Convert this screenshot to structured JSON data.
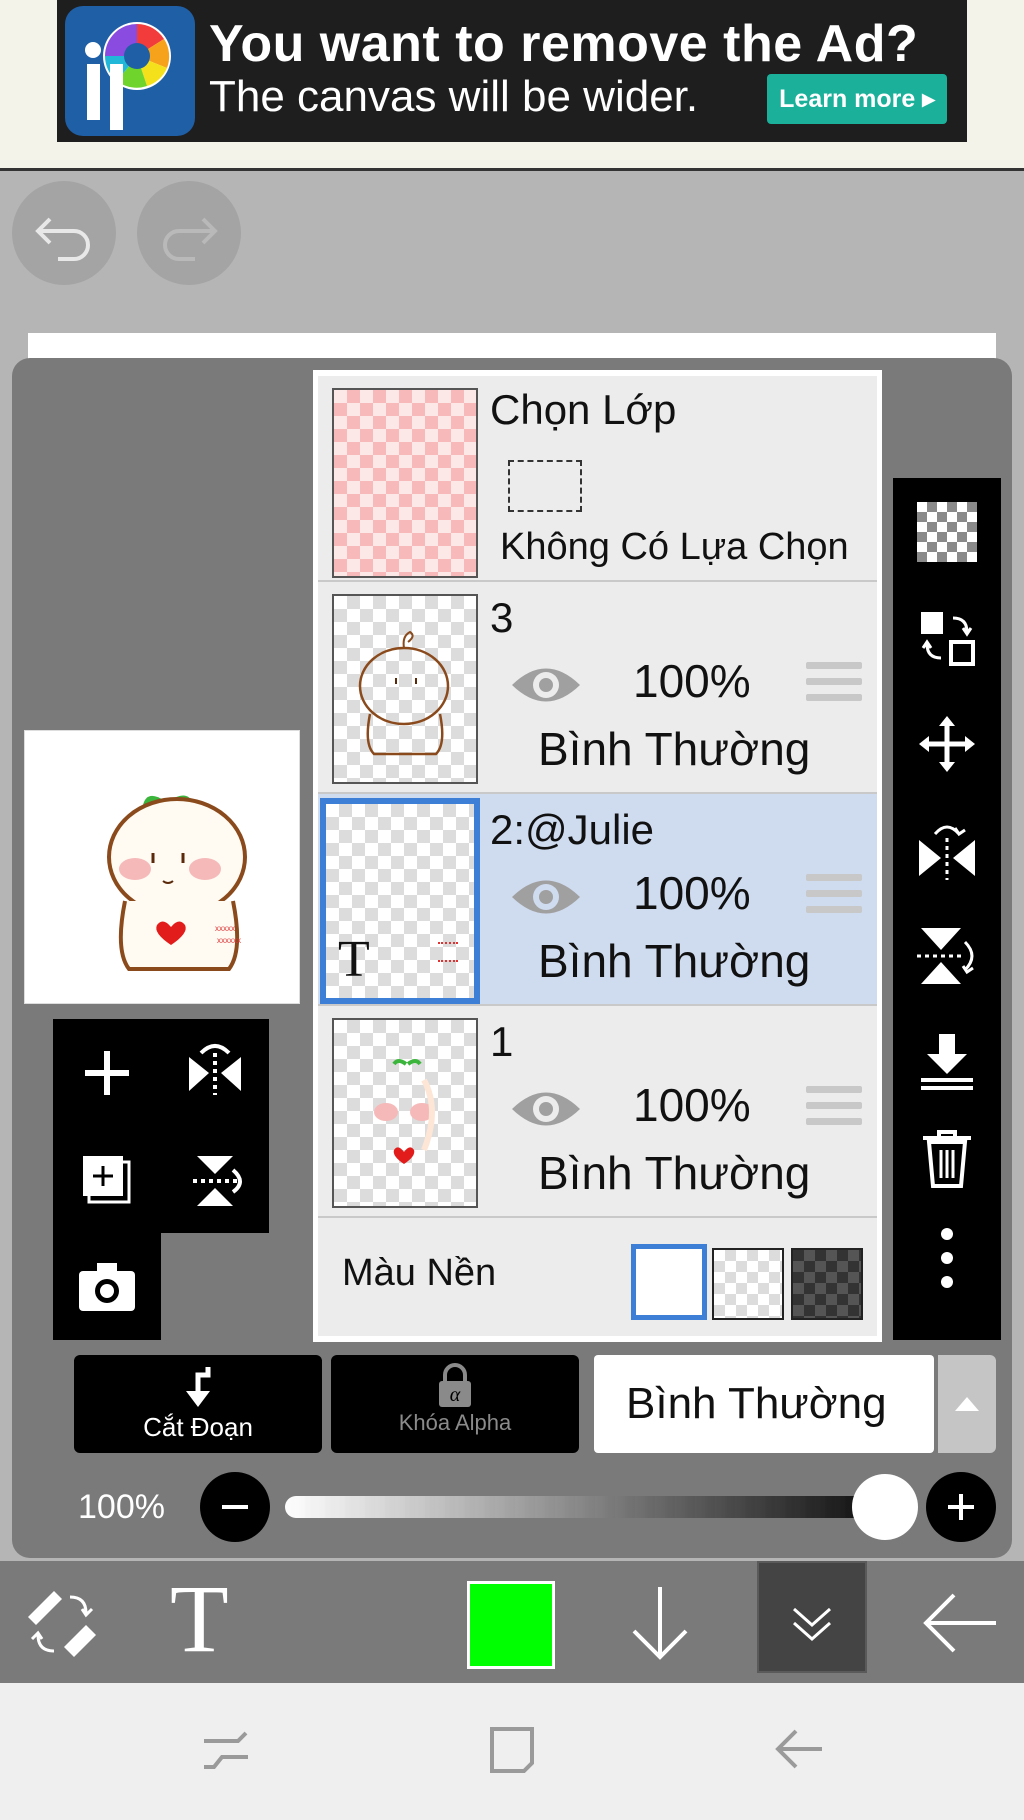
{
  "ad": {
    "title": "You want to remove the Ad?",
    "subtitle": "The canvas will be wider.",
    "learn_more": "Learn more",
    "logo_text": "iP"
  },
  "layers": {
    "selection": {
      "title": "Chọn Lớp",
      "status": "Không Có Lựa Chọn"
    },
    "items": [
      {
        "name": "3",
        "opacity": "100%",
        "blend": "Bình Thường",
        "selected": false
      },
      {
        "name": "2:@Julie",
        "opacity": "100%",
        "blend": "Bình Thường",
        "selected": true
      },
      {
        "name": "1",
        "opacity": "100%",
        "blend": "Bình Thường",
        "selected": false
      }
    ],
    "background": {
      "label": "Màu Nền"
    }
  },
  "controls": {
    "clipping_label": "Cắt Đoạn",
    "alpha_lock_label": "Khóa Alpha",
    "blend_mode": "Bình Thường",
    "opacity_value": "100%",
    "opacity_fraction": 1.0
  },
  "colors": {
    "current_color": "#00ff00",
    "selection_highlight": "#cfdbef",
    "accent_blue": "#3d7fd6",
    "ad_button": "#1bb09a"
  },
  "icons": {
    "undo": "undo-icon",
    "redo": "redo-icon",
    "layer_tools": [
      "checker-icon",
      "swap-icon",
      "move-icon",
      "flip-horizontal-icon",
      "flip-vertical-icon",
      "merge-down-icon",
      "trash-icon",
      "more-icon"
    ],
    "bottom_tools": [
      "eraser-swap-icon",
      "text-icon",
      "color-swatch",
      "download-icon",
      "collapse-icon",
      "back-arrow-icon"
    ],
    "nav": [
      "recent-apps-icon",
      "home-icon",
      "back-icon"
    ]
  }
}
